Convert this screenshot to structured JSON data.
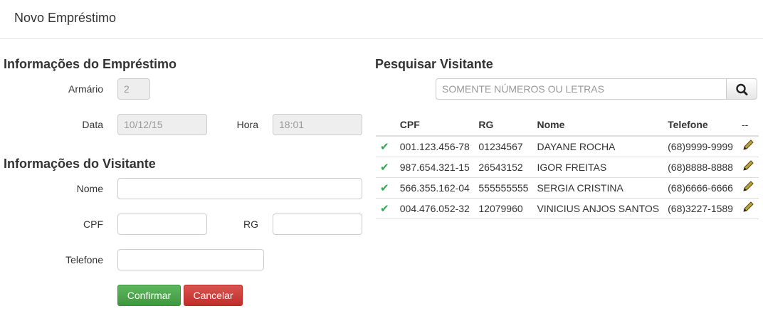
{
  "header": {
    "title": "Novo Empréstimo"
  },
  "loan_info": {
    "heading": "Informações do Empréstimo",
    "locker_label": "Armário",
    "locker_value": "2",
    "date_label": "Data",
    "date_value": "10/12/15",
    "time_label": "Hora",
    "time_value": "18:01"
  },
  "visitor_info": {
    "heading": "Informações do Visitante",
    "name_label": "Nome",
    "name_value": "",
    "cpf_label": "CPF",
    "cpf_value": "",
    "rg_label": "RG",
    "rg_value": "",
    "phone_label": "Telefone",
    "phone_value": ""
  },
  "actions": {
    "confirm_label": "Confirmar",
    "cancel_label": "Cancelar"
  },
  "search": {
    "heading": "Pesquisar Visitante",
    "placeholder": "SOMENTE NÚMEROS OU LETRAS",
    "icon": "search-icon"
  },
  "table": {
    "columns": [
      "CPF",
      "RG",
      "Nome",
      "Telefone",
      "--"
    ],
    "rows": [
      {
        "cpf": "001.123.456-78",
        "rg": "01234567",
        "name": "DAYANE ROCHA",
        "phone": "(68)9999-9999"
      },
      {
        "cpf": "987.654.321-15",
        "rg": "26543152",
        "name": "IGOR FREITAS",
        "phone": "(68)8888-8888"
      },
      {
        "cpf": "566.355.162-04",
        "rg": "555555555",
        "name": "SERGIA CRISTINA",
        "phone": "(68)6666-6666"
      },
      {
        "cpf": "004.476.052-32",
        "rg": "12079960",
        "name": "VINICIUS ANJOS SANTOS",
        "phone": "(68)3227-1589"
      }
    ]
  },
  "colors": {
    "success": "#5cb85c",
    "danger": "#d9534f",
    "check": "#2fa84f",
    "pencil": "#8a7d2b"
  }
}
